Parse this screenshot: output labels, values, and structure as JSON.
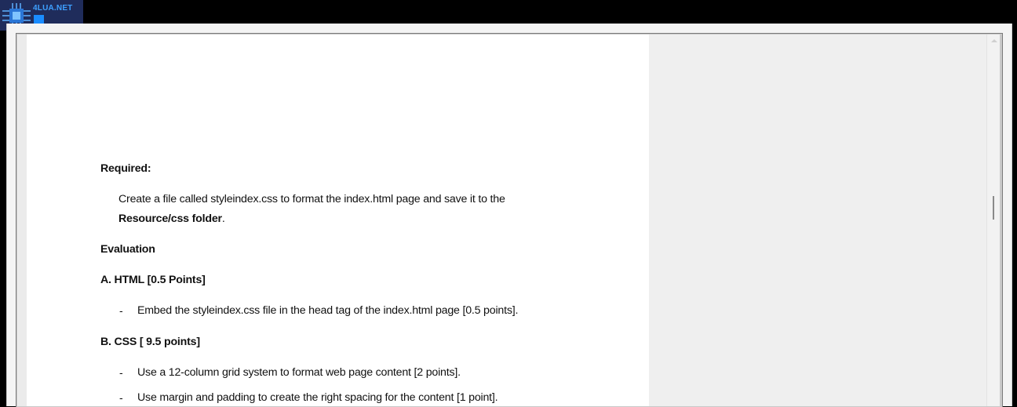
{
  "logo": {
    "text": "4LUA.NET"
  },
  "document": {
    "required_heading": "Required:",
    "required_line1": "Create a file called styleindex.css to format the index.html page and save it to the",
    "required_folder": "Resource/css  folder",
    "required_period": ".",
    "evaluation_heading": "Evaluation",
    "section_a_heading": "A. HTML  [0.5 Points]",
    "section_a_items": [
      "Embed the styleindex.css file in the head tag of the index.html page [0.5 points]."
    ],
    "section_b_heading": "B. CSS  [ 9.5 points]",
    "section_b_items": [
      "Use a 12-column grid system to format web page content [2 points].",
      "Use margin and padding to create the right spacing for the content [1 point]."
    ],
    "bullet": "-"
  }
}
